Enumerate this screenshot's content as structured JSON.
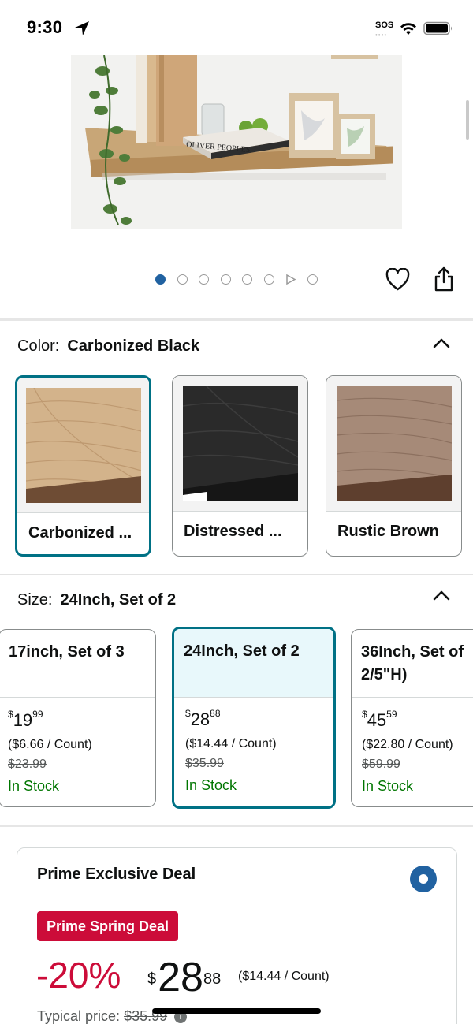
{
  "status_bar": {
    "time": "9:30",
    "sos": "SOS"
  },
  "carousel": {
    "total": 8,
    "active_index": 0
  },
  "color": {
    "label": "Color:",
    "selected": "Carbonized Black",
    "options": [
      {
        "label": "Carbonized ...",
        "selected": true,
        "tone": "#c9a77f"
      },
      {
        "label": "Distressed ...",
        "selected": false,
        "tone": "#2b2b2b"
      },
      {
        "label": "Rustic Brown",
        "selected": false,
        "tone": "#9c7e6a"
      }
    ]
  },
  "size": {
    "label": "Size:",
    "selected": "24Inch, Set of 2",
    "options": [
      {
        "title": "17inch, Set of 3",
        "price_whole": "19",
        "price_cents": "99",
        "unit": "($6.66 / Count)",
        "was": "$23.99",
        "stock": "In Stock",
        "selected": false
      },
      {
        "title": "24Inch, Set of 2",
        "price_whole": "28",
        "price_cents": "88",
        "unit": "($14.44 / Count)",
        "was": "$35.99",
        "stock": "In Stock",
        "selected": true
      },
      {
        "title": "36Inch, Set of 2/5\"H)",
        "price_whole": "45",
        "price_cents": "59",
        "unit": "($22.80 / Count)",
        "was": "$59.99",
        "stock": "In Stock",
        "selected": false
      }
    ]
  },
  "deal": {
    "title": "Prime Exclusive Deal",
    "badge": "Prime Spring Deal",
    "discount": "-20%",
    "currency": "$",
    "price_whole": "28",
    "price_cents": "88",
    "unit": "($14.44 / Count)",
    "typical_label": "Typical price:",
    "typical_price": "$35.99"
  },
  "colors": {
    "accent": "#007185",
    "deal_red": "#cc0c39",
    "stock_green": "#007600",
    "dot_blue": "#2162a1"
  }
}
